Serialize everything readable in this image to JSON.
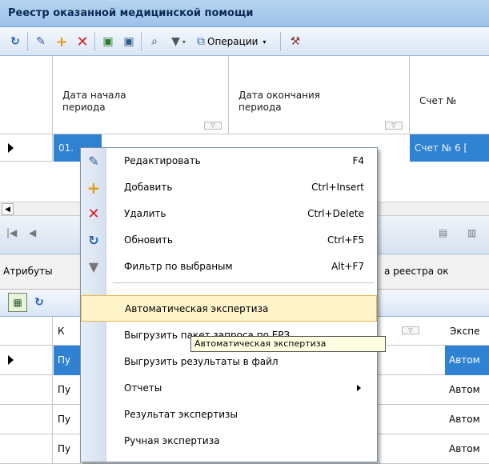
{
  "window": {
    "title": "Реестр оказанной медицинской помощи"
  },
  "toolbar": {
    "operations_label": "Операции"
  },
  "main_grid": {
    "columns": [
      "Дата начала периода",
      "Дата окончания периода",
      "Счет №"
    ],
    "row": {
      "start_date": "01.",
      "invoice": "Счет № 6 ["
    }
  },
  "tabs": {
    "attributes": "Атрибуты",
    "registry_tail": "а реестра ок"
  },
  "detail_grid": {
    "header_tail": "Экспе",
    "header_k": "К",
    "rows": [
      {
        "c1": "Пу",
        "c2": "Автом"
      },
      {
        "c1": "Пу",
        "c2": "Автом"
      },
      {
        "c1": "Пу",
        "c2": "Автом"
      },
      {
        "c1": "Пу",
        "c2": "Автом"
      }
    ]
  },
  "context_menu": {
    "items": [
      {
        "label": "Редактировать",
        "shortcut": "F4"
      },
      {
        "label": "Добавить",
        "shortcut": "Ctrl+Insert"
      },
      {
        "label": "Удалить",
        "shortcut": "Ctrl+Delete"
      },
      {
        "label": "Обновить",
        "shortcut": "Ctrl+F5"
      },
      {
        "label": "Фильтр по выбраным",
        "shortcut": "Alt+F7"
      },
      {
        "label": "Автоматическая экспертиза",
        "shortcut": ""
      },
      {
        "label": "Выгрузить пакет запроса по ЕРЗ",
        "shortcut": ""
      },
      {
        "label": "Выгрузить результаты в файл",
        "shortcut": ""
      },
      {
        "label": "Отчеты",
        "shortcut": ""
      },
      {
        "label": "Результат экспертизы",
        "shortcut": ""
      },
      {
        "label": "Ручная экспертиза",
        "shortcut": ""
      }
    ]
  },
  "tooltip": {
    "text": "Автоматическая экспертиза"
  },
  "colors": {
    "selection": "#2f82d2",
    "highlight": "#fff3c9",
    "title_bg": "#b7d3f1"
  }
}
